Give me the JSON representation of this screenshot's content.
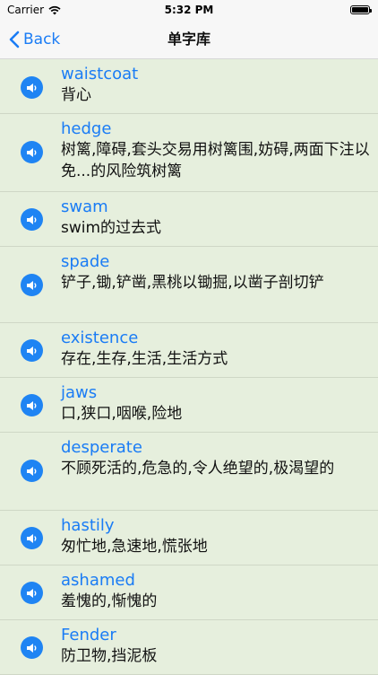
{
  "status_bar": {
    "carrier": "Carrier",
    "time": "5:32 PM"
  },
  "nav": {
    "back_label": "Back",
    "title": "单字库"
  },
  "words": [
    {
      "word": "waistcoat",
      "meaning": "背心"
    },
    {
      "word": "hedge",
      "meaning": "树篱,障碍,套头交易用树篱围,妨碍,两面下注以免...的风险筑树篱"
    },
    {
      "word": "swam",
      "meaning": "swim的过去式"
    },
    {
      "word": "spade",
      "meaning": "铲子,锄,铲凿,黑桃以锄掘,以凿子剖切铲"
    },
    {
      "word": "existence",
      "meaning": "存在,生存,生活,生活方式"
    },
    {
      "word": "jaws",
      "meaning": "口,狭口,咽喉,险地"
    },
    {
      "word": "desperate",
      "meaning": "不顾死活的,危急的,令人绝望的,极渴望的"
    },
    {
      "word": "hastily",
      "meaning": "匆忙地,急速地,慌张地"
    },
    {
      "word": "ashamed",
      "meaning": "羞愧的,惭愧的"
    },
    {
      "word": "Fender",
      "meaning": "防卫物,挡泥板"
    }
  ]
}
